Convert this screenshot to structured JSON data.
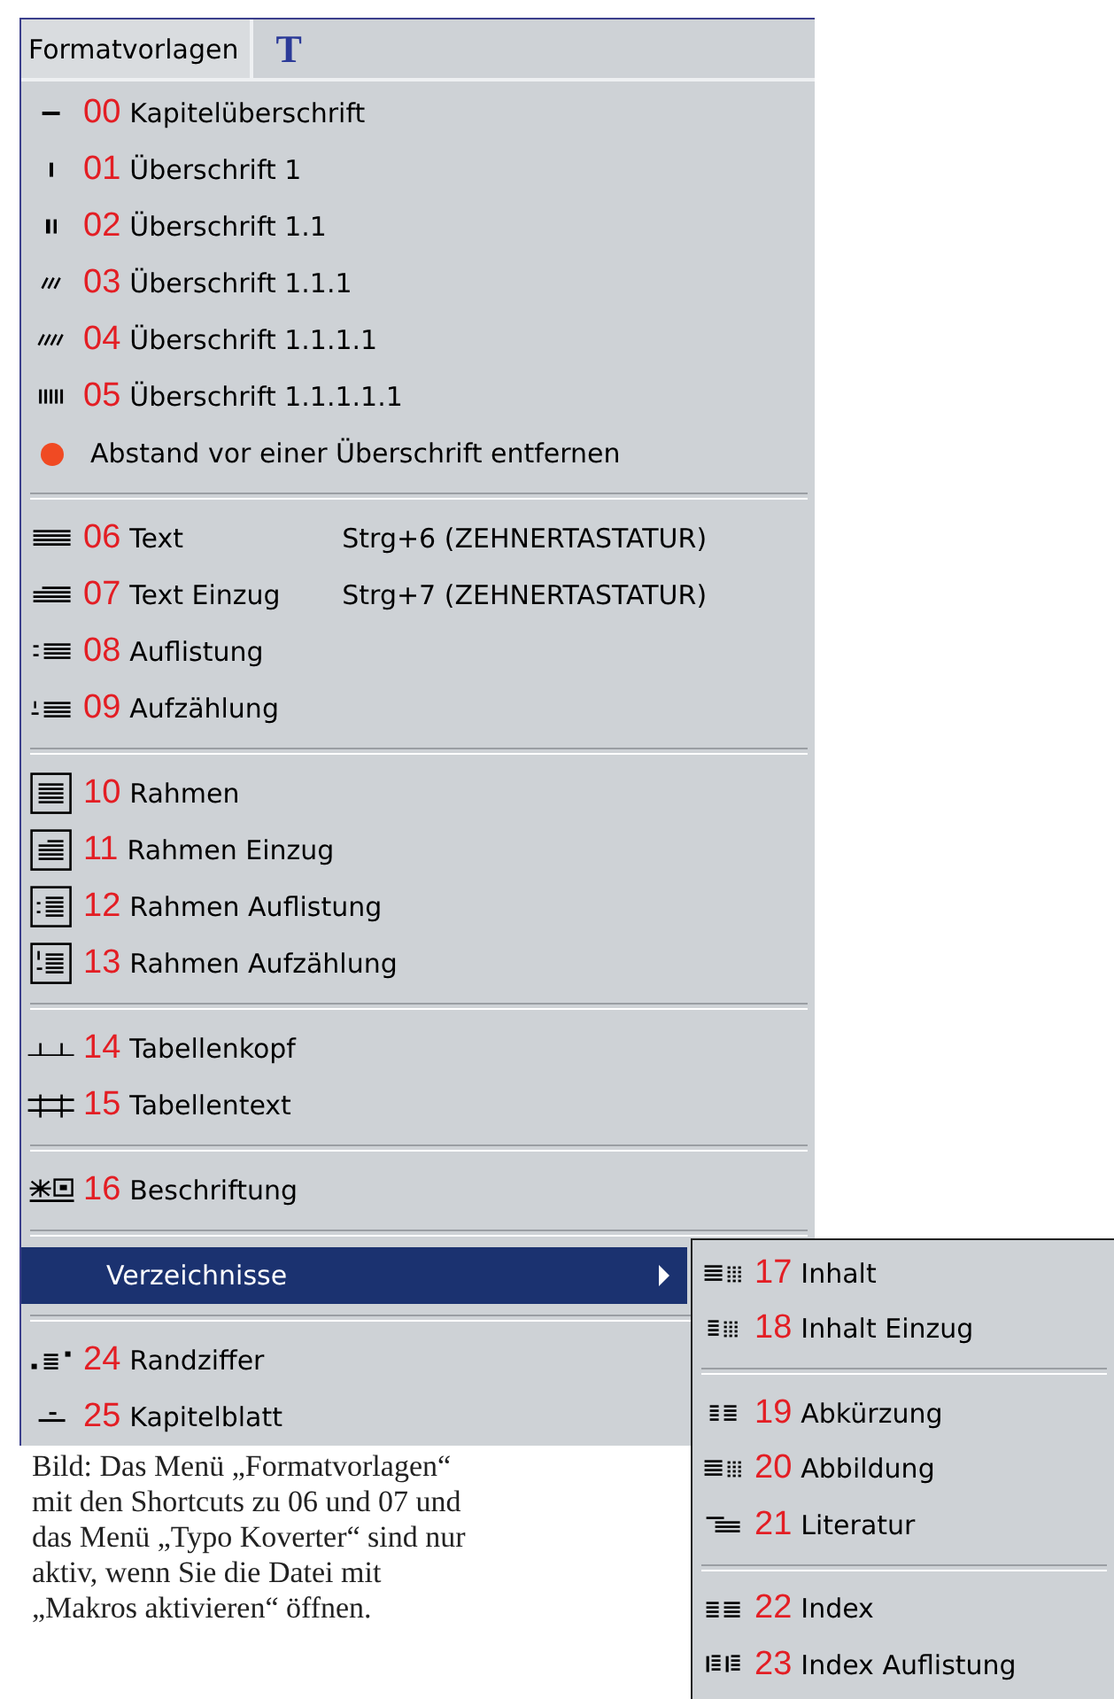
{
  "menu": {
    "tab": "Formatvorlagen",
    "tab_icon": "T",
    "items": [
      {
        "kind": "style",
        "number": "00",
        "label": "Kapitelüberschrift",
        "selected": false
      },
      {
        "kind": "style",
        "number": "01",
        "label": "Überschrift 1",
        "selected": false
      },
      {
        "kind": "style",
        "number": "02",
        "label": "Überschrift 1.1",
        "selected": false
      },
      {
        "kind": "style",
        "number": "03",
        "label": "Überschrift 1.1.1",
        "selected": false
      },
      {
        "kind": "style",
        "number": "04",
        "label": "Überschrift 1.1.1.1",
        "selected": false
      },
      {
        "kind": "style",
        "number": "05",
        "label": "Überschrift 1.1.1.1.1",
        "selected": false
      },
      {
        "kind": "action",
        "label": "Abstand vor einer Überschrift entfernen",
        "selected": false
      },
      {
        "kind": "separator"
      },
      {
        "kind": "style",
        "number": "06",
        "label": "Text",
        "shortcut": "Strg+6 (ZEHNERTASTATUR)",
        "selected": false
      },
      {
        "kind": "style",
        "number": "07",
        "label": "Text Einzug",
        "shortcut": "Strg+7 (ZEHNERTASTATUR)",
        "selected": false
      },
      {
        "kind": "style",
        "number": "08",
        "label": "Auflistung",
        "selected": false
      },
      {
        "kind": "style",
        "number": "09",
        "label": "Aufzählung",
        "selected": false
      },
      {
        "kind": "separator"
      },
      {
        "kind": "style",
        "number": "10",
        "label": "Rahmen",
        "selected": false
      },
      {
        "kind": "style",
        "number": "11",
        "label": "Rahmen Einzug",
        "selected": false
      },
      {
        "kind": "style",
        "number": "12",
        "label": "Rahmen Auflistung",
        "selected": false
      },
      {
        "kind": "style",
        "number": "13",
        "label": "Rahmen Aufzählung",
        "selected": false
      },
      {
        "kind": "separator"
      },
      {
        "kind": "style",
        "number": "14",
        "label": "Tabellenkopf",
        "selected": false
      },
      {
        "kind": "style",
        "number": "15",
        "label": "Tabellentext",
        "selected": false
      },
      {
        "kind": "separator"
      },
      {
        "kind": "style",
        "number": "16",
        "label": "Beschriftung",
        "selected": false
      },
      {
        "kind": "separator"
      },
      {
        "kind": "submenu",
        "label": "Verzeichnisse",
        "selected": true
      },
      {
        "kind": "separator"
      },
      {
        "kind": "style",
        "number": "24",
        "label": "Randziffer",
        "selected": false
      },
      {
        "kind": "style",
        "number": "25",
        "label": "Kapitelblatt",
        "selected": false
      }
    ]
  },
  "submenu": {
    "items": [
      {
        "kind": "style",
        "number": "17",
        "label": "Inhalt",
        "selected": false
      },
      {
        "kind": "style",
        "number": "18",
        "label": "Inhalt Einzug",
        "selected": false
      },
      {
        "kind": "separator"
      },
      {
        "kind": "style",
        "number": "19",
        "label": "Abkürzung",
        "selected": false
      },
      {
        "kind": "style",
        "number": "20",
        "label": "Abbildung",
        "selected": false
      },
      {
        "kind": "style",
        "number": "21",
        "label": "Literatur",
        "selected": false
      },
      {
        "kind": "separator"
      },
      {
        "kind": "style",
        "number": "22",
        "label": "Index",
        "selected": false
      },
      {
        "kind": "style",
        "number": "23",
        "label": "Index Auflistung",
        "selected": false
      }
    ]
  },
  "caption": "Bild: Das Menü „Formatvorlagen“ mit den Shortcuts zu 06 und 07 und das Menü „Typo Koverter“ sind nur aktiv, wenn Sie die Datei mit „Makros aktivieren“ öffnen."
}
